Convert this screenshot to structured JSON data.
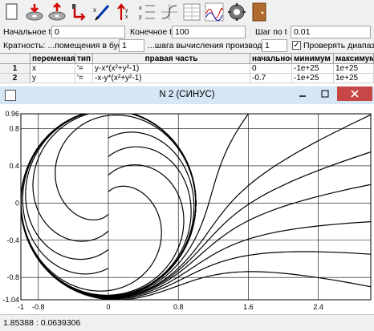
{
  "toolbar": {
    "buttons": [
      {
        "name": "new-document-icon"
      },
      {
        "name": "disk-load-icon"
      },
      {
        "name": "disk-save-icon"
      },
      {
        "name": "step-down-arrow-icon"
      },
      {
        "name": "pen-edit-icon"
      },
      {
        "name": "axis-up-arrow-icon"
      },
      {
        "name": "function-table-icon"
      },
      {
        "name": "phase-graph-icon"
      },
      {
        "name": "table-data-icon"
      },
      {
        "name": "time-plot-icon"
      },
      {
        "name": "settings-gear-icon"
      },
      {
        "name": "exit-door-icon"
      }
    ]
  },
  "params": {
    "start_t_label": "Начальное t",
    "start_t_value": "0",
    "end_t_label": "Конечное  t",
    "end_t_value": "100",
    "step_t_label": "Шаг по  t",
    "step_t_value": "0.01",
    "multiplicity_label": "Кратность: ...помещения в буфер",
    "multiplicity_value": "1",
    "derivative_step_label": "...шага вычисления производной",
    "derivative_step_value": "1",
    "check_range_label": "Проверять диапазон",
    "check_range_checked": true
  },
  "equations": {
    "headers": [
      "переменая",
      "тип",
      "правая часть",
      "начальное",
      "минимум",
      "максимум"
    ],
    "rows": [
      {
        "index": "1",
        "variable": "x",
        "type": "'=",
        "rhs": "y-x*(x²+y²-1)",
        "initial": "0",
        "min": "-1e+25",
        "max": "1e+25"
      },
      {
        "index": "2",
        "variable": "y",
        "type": "'=",
        "rhs": "-x-y*(x²+y²-1)",
        "initial": "-0.7",
        "min": "-1e+25",
        "max": "1e+25"
      }
    ]
  },
  "window": {
    "title": "N 2 (СИНУС)",
    "status": "1.85388 : 0.0639306"
  },
  "plot": {
    "x_ticks": [
      "-1",
      "-0.8",
      "0",
      "0.8",
      "1.6",
      "2.4"
    ],
    "y_ticks": [
      "0.96",
      "0.8",
      "0.4",
      "0",
      "-0.4",
      "-0.8",
      "-1.04"
    ],
    "xlim": [
      -1,
      3.0
    ],
    "ylim": [
      -1.04,
      0.96
    ]
  }
}
